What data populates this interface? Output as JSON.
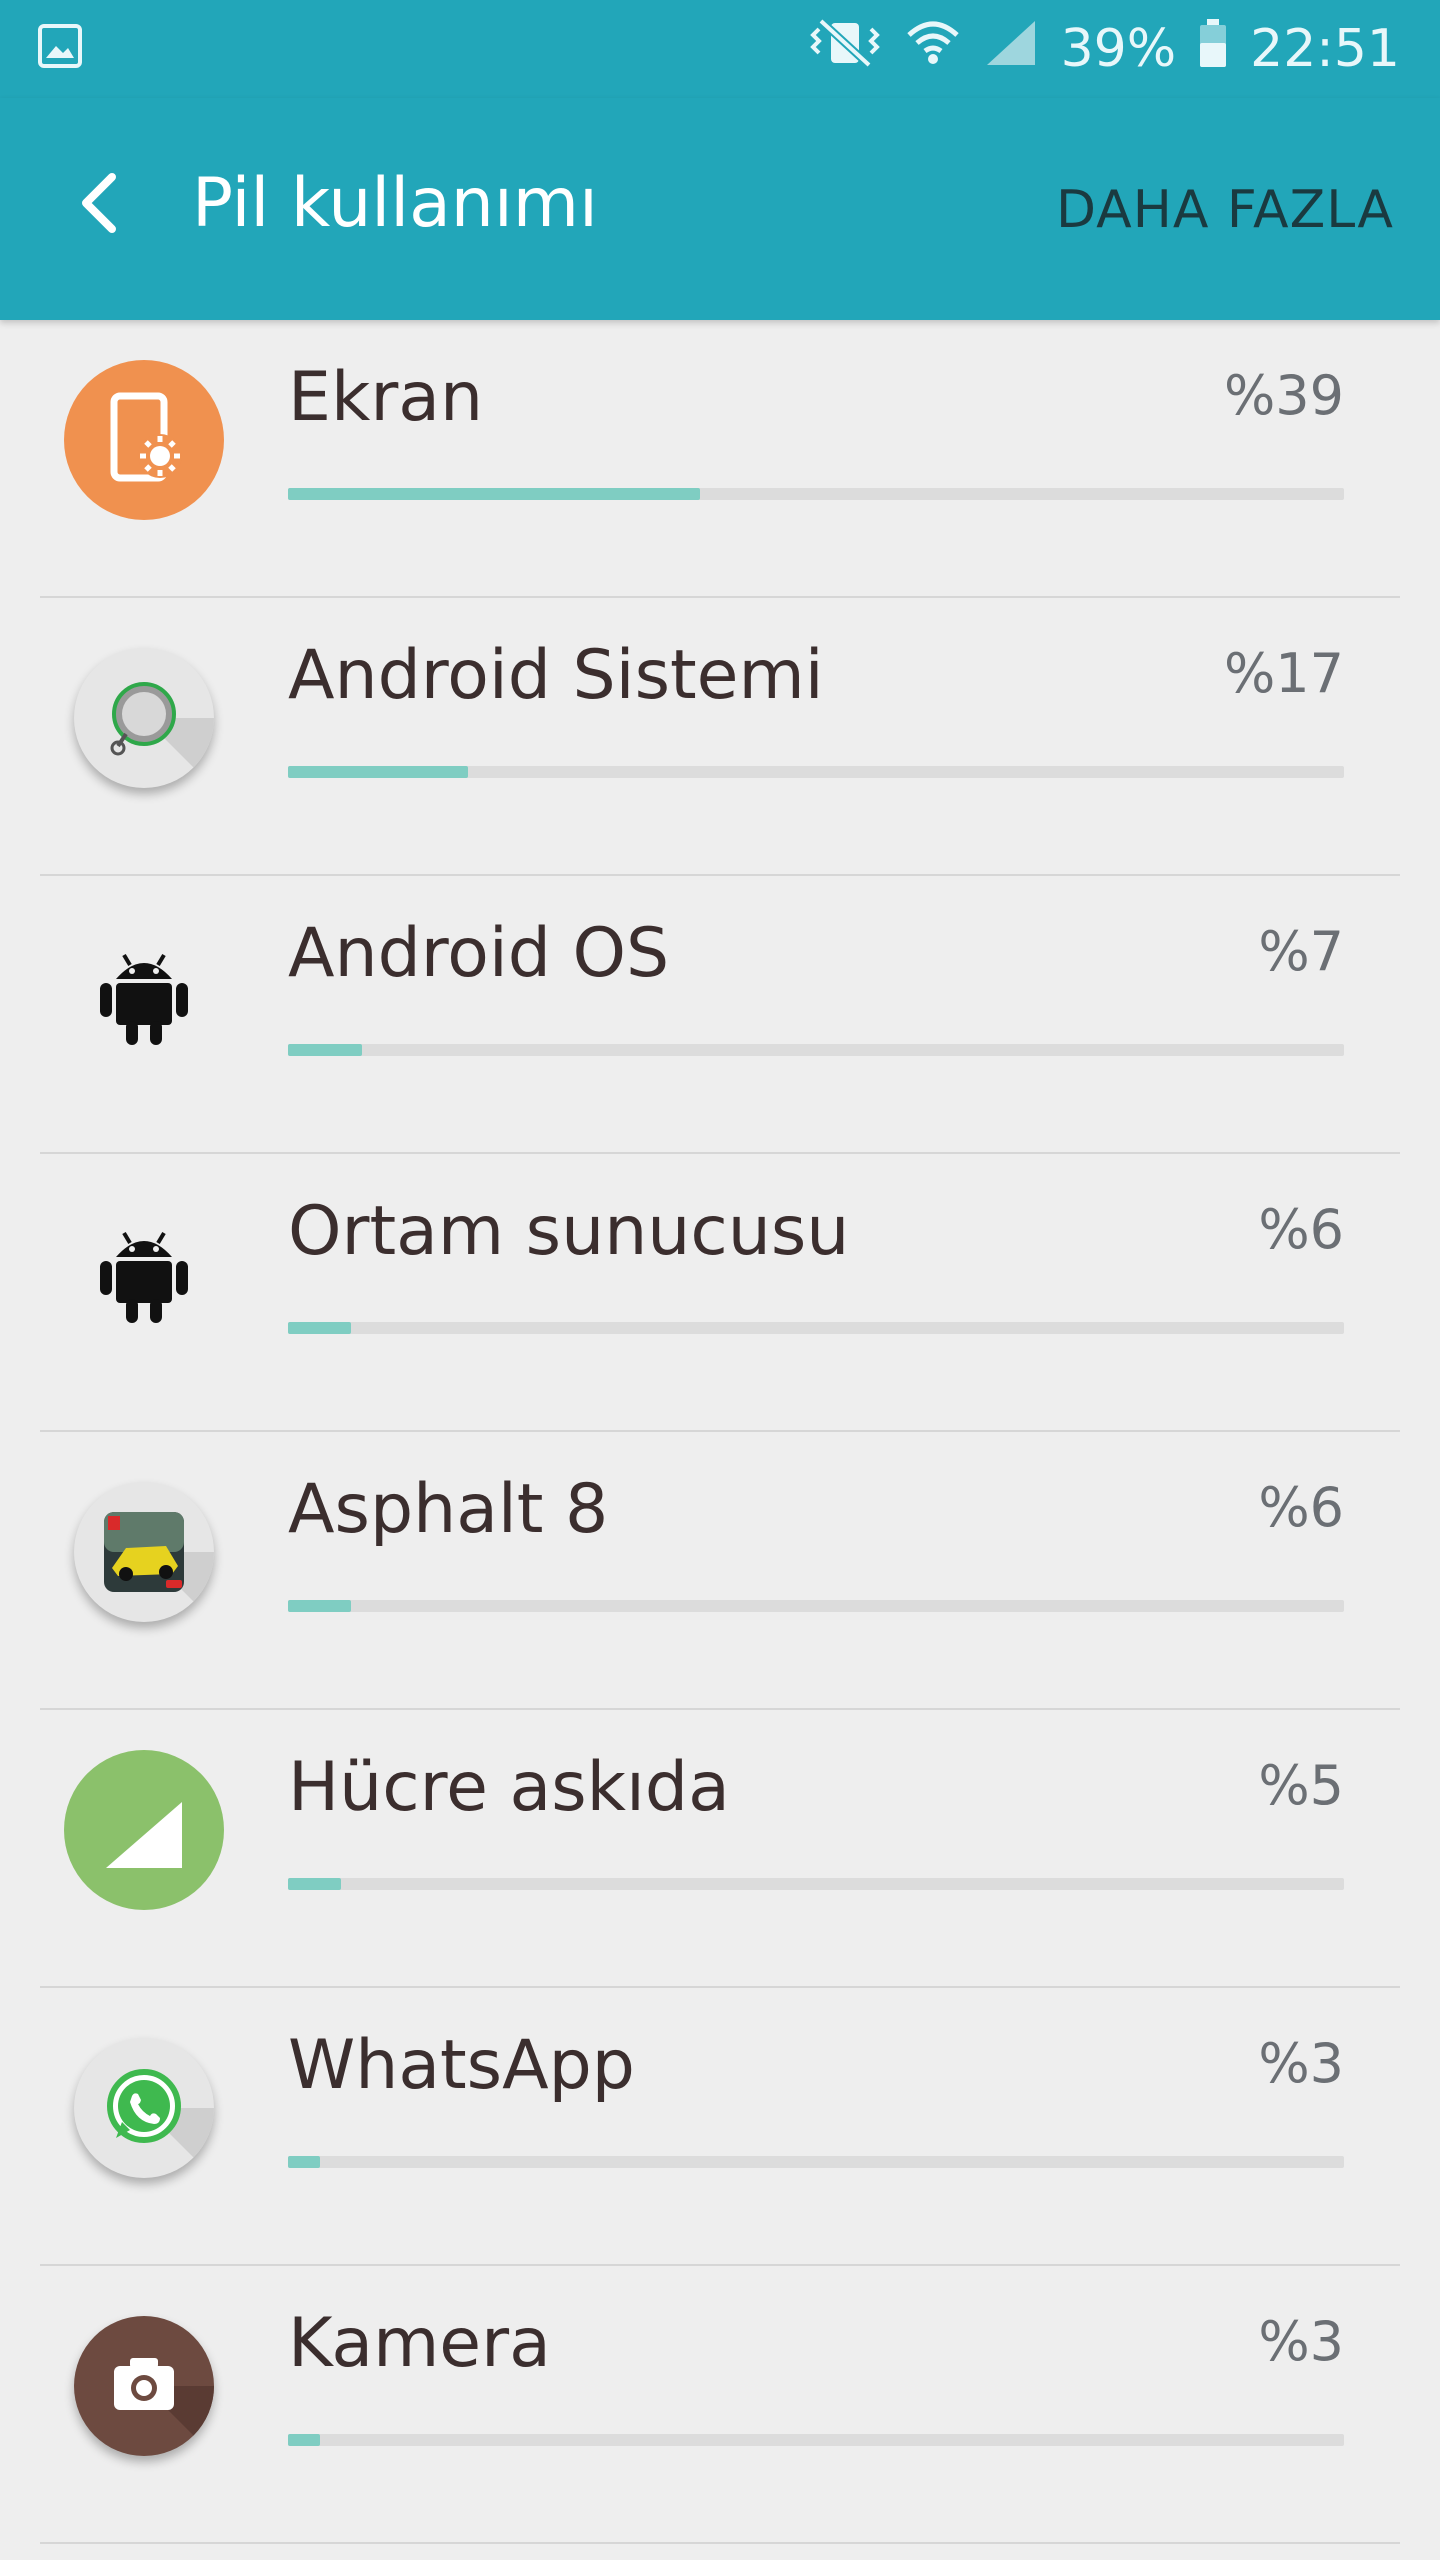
{
  "status_bar": {
    "battery_percent_text": "39%",
    "time": "22:51"
  },
  "app_bar": {
    "title": "Pil kullanımı",
    "more_label": "DAHA FAZLA"
  },
  "accent_color": "#22a6b9",
  "bar_fill_color": "#7fcdc2",
  "items": [
    {
      "name": "Ekran",
      "percent_text": "%39",
      "percent": 39,
      "icon": "screen-brightness-icon",
      "icon_bg": "#f0914f"
    },
    {
      "name": "Android Sistemi",
      "percent_text": "%17",
      "percent": 17,
      "icon": "android-system-icon",
      "icon_bg": "#e6e6e6"
    },
    {
      "name": "Android OS",
      "percent_text": "%7",
      "percent": 7,
      "icon": "android-robot-icon",
      "icon_bg": "transparent"
    },
    {
      "name": "Ortam sunucusu",
      "percent_text": "%6",
      "percent": 6,
      "icon": "android-robot-icon",
      "icon_bg": "transparent"
    },
    {
      "name": "Asphalt 8",
      "percent_text": "%6",
      "percent": 6,
      "icon": "asphalt-8-app-icon",
      "icon_bg": "#e6e6e6"
    },
    {
      "name": "Hücre askıda",
      "percent_text": "%5",
      "percent": 5,
      "icon": "cell-signal-icon",
      "icon_bg": "#8bc16b"
    },
    {
      "name": "WhatsApp",
      "percent_text": "%3",
      "percent": 3,
      "icon": "whatsapp-icon",
      "icon_bg": "#e6e6e6"
    },
    {
      "name": "Kamera",
      "percent_text": "%3",
      "percent": 3,
      "icon": "camera-icon",
      "icon_bg": "#6d4a40"
    }
  ]
}
